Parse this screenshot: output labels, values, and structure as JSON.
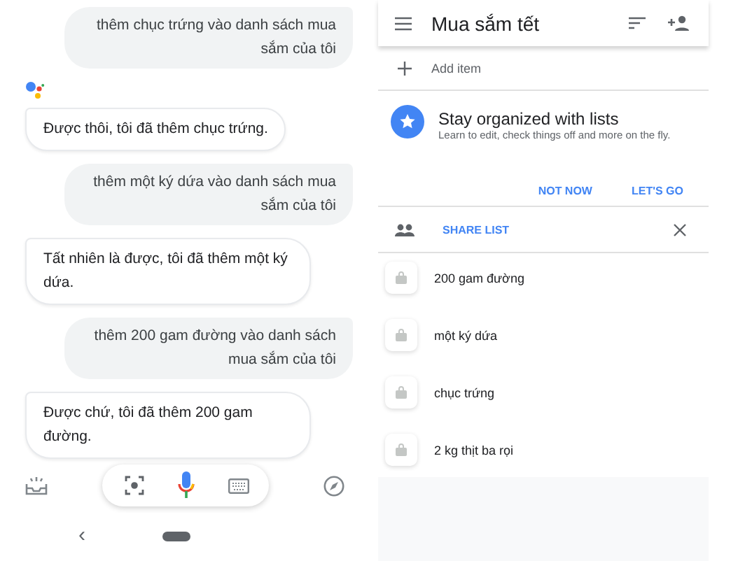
{
  "chat": {
    "messages": [
      {
        "kind": "user",
        "text": "thêm chục trứng vào danh sách mua sắm của tôi"
      },
      {
        "kind": "logo"
      },
      {
        "kind": "assistant",
        "text": "Được thôi, tôi đã thêm chục trứng."
      },
      {
        "kind": "user",
        "text": "thêm một ký dứa vào danh sách mua sắm của tôi"
      },
      {
        "kind": "assistant",
        "text": "Tất nhiên là được, tôi đã thêm một ký dứa."
      },
      {
        "kind": "user",
        "text": "thêm 200 gam đường vào danh sách mua sắm của tôi"
      },
      {
        "kind": "assistant",
        "text": "Được chứ, tôi đã thêm 200 gam đường."
      }
    ]
  },
  "nav_bar": {
    "back": "‹"
  },
  "list": {
    "title": "Mua sắm tết",
    "add_item": {
      "placeholder": "Add item"
    },
    "promo": {
      "title": "Stay organized with lists",
      "text": "Learn to edit, check things off and more on the fly.",
      "buttons": [
        "NOT NOW",
        "LET'S GO"
      ]
    },
    "share": {
      "label": "SHARE LIST"
    },
    "items": [
      {
        "text": "200 gam đường"
      },
      {
        "text": "một ký dứa"
      },
      {
        "text": "chục trứng"
      },
      {
        "text": "2 kg thịt ba rọi"
      }
    ]
  }
}
